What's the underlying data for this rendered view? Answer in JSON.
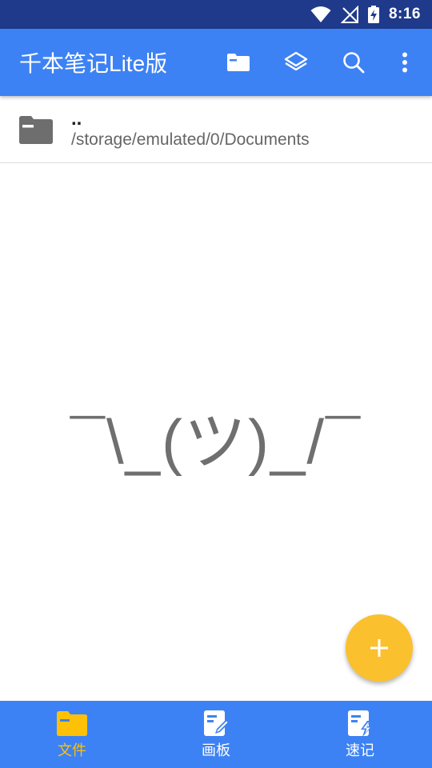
{
  "status_bar": {
    "time": "8:16"
  },
  "app_bar": {
    "title": "千本笔记Lite版",
    "actions": [
      {
        "name": "folder-icon"
      },
      {
        "name": "layers-icon"
      },
      {
        "name": "search-icon"
      },
      {
        "name": "more-vert-icon"
      }
    ]
  },
  "file_list": {
    "items": [
      {
        "name": "..",
        "path": "/storage/emulated/0/Documents",
        "icon": "folder-icon"
      }
    ]
  },
  "empty_state": {
    "text": "¯\\_(ツ)_/¯"
  },
  "fab": {
    "icon": "plus-icon",
    "color": "#fbc02d"
  },
  "bottom_nav": {
    "items": [
      {
        "label": "文件",
        "icon": "folder-icon",
        "active": true
      },
      {
        "label": "画板",
        "icon": "drawing-board-icon",
        "active": false
      },
      {
        "label": "速记",
        "icon": "quick-note-icon",
        "active": false
      }
    ]
  },
  "colors": {
    "primary": "#3d82f4",
    "status_bar": "#1f3a8a",
    "accent": "#ffc107"
  }
}
